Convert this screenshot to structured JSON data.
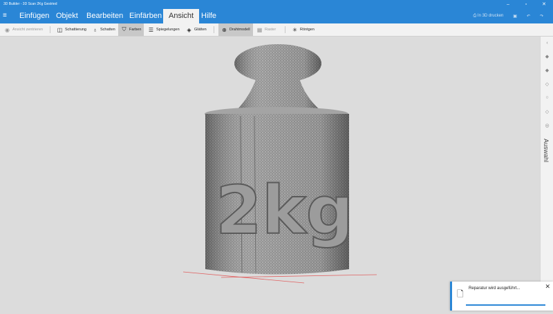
{
  "window": {
    "title": "3D Builder - 3D Scan 2Kg Gestried"
  },
  "tabs": [
    {
      "label": "Einfügen"
    },
    {
      "label": "Objekt"
    },
    {
      "label": "Bearbeiten"
    },
    {
      "label": "Einfärben"
    },
    {
      "label": "Ansicht",
      "active": true
    },
    {
      "label": "Hilfe"
    }
  ],
  "header_right": {
    "print_label": "In 3D drucken"
  },
  "toolbar": {
    "center_view": "Ansicht zentrieren",
    "shading": "Schattierung",
    "shadows": "Schatten",
    "colors": "Farben",
    "reflections": "Spiegelungen",
    "smooth": "Glätten",
    "wireframe": "Drahtmodell",
    "grid": "Raster",
    "xray": "Röntgen"
  },
  "right_panel": {
    "label": "Auswahl"
  },
  "toast": {
    "message": "Reparatur wird ausgeführt..."
  },
  "model": {
    "engraving": "2kg"
  },
  "colors": {
    "accent": "#2a86d6",
    "viewport": "#dcdcdc"
  }
}
